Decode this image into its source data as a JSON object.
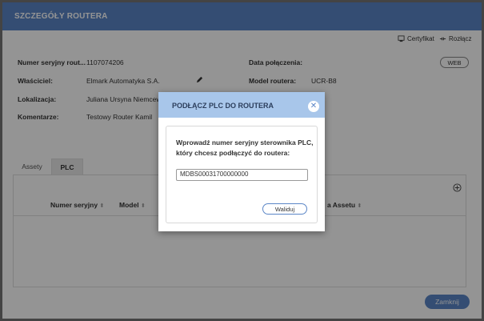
{
  "header": {
    "title": "SZCZEGÓŁY ROUTERA"
  },
  "toolbar": {
    "certificate_label": "Certyfikat",
    "disconnect_label": "Rozłącz"
  },
  "details": {
    "serial_label": "Numer seryjny rout...",
    "serial_value": "1107074206",
    "owner_label": "Właściciel:",
    "owner_value": "Elmark Automatyka S.A.",
    "location_label": "Lokalizacja:",
    "location_value": "Juliana Ursyna Niemcewi",
    "comment_label": "Komentarze:",
    "comment_value": "Testowy Router Kamil",
    "connection_label": "Data połączenia:",
    "model_label": "Model routera:",
    "model_value": "UCR-B8",
    "web_label": "WEB"
  },
  "tabs": [
    {
      "label": "Assety"
    },
    {
      "label": "PLC"
    }
  ],
  "table": {
    "headers": [
      "Numer seryjny",
      "Model",
      "a Assetu"
    ]
  },
  "footer": {
    "close_label": "Zamknij"
  },
  "modal": {
    "title": "PODŁĄCZ PLC DO ROUTERA",
    "prompt": "Wprowadź numer seryjny sterownika PLC, który chcesz podłączyć do routera:",
    "input_value": "MDBS00031700000000",
    "validate_label": "Waliduj"
  },
  "colors": {
    "accent": "#5b86c7",
    "modal_header": "#a8c6ea"
  }
}
